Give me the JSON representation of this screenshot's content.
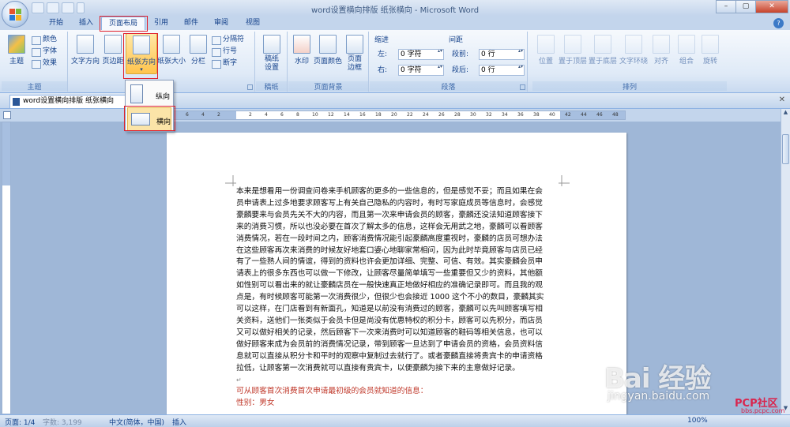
{
  "window": {
    "title": "word设置横向排版 纸张横向 - Microsoft Word"
  },
  "tabs": [
    {
      "label": "开始"
    },
    {
      "label": "插入"
    },
    {
      "label": "页面布局"
    },
    {
      "label": "引用"
    },
    {
      "label": "邮件"
    },
    {
      "label": "审阅"
    },
    {
      "label": "视图"
    }
  ],
  "ribbon": {
    "theme": {
      "big": "主题",
      "colors": "颜色",
      "fonts": "字体",
      "effects": "效果",
      "group": "主题"
    },
    "page_setup": {
      "text_direction": "文字方向",
      "margins": "页边距",
      "orientation": "纸张方向",
      "size": "纸张大小",
      "columns": "分栏",
      "breaks": "分隔符",
      "line_numbers": "行号",
      "hyphenation": "断字"
    },
    "draft": {
      "label": "稿纸设置",
      "group": "稿纸"
    },
    "background": {
      "watermark": "水印",
      "page_color": "页面颜色",
      "page_borders": "页面边框",
      "group": "页面背景"
    },
    "paragraph": {
      "indent": "缩进",
      "spacing": "间距",
      "left_label": "左:",
      "left_value": "0 字符",
      "right_label": "右:",
      "right_value": "0 字符",
      "before_label": "段前:",
      "before_value": "0 行",
      "after_label": "段后:",
      "after_value": "0 行",
      "group": "段落"
    },
    "arrange": {
      "position": "位置",
      "bring_front": "置于顶层",
      "send_back": "置于底层",
      "wrap": "文字环绕",
      "align": "对齐",
      "group_btn": "组合",
      "rotate": "旋转",
      "group": "排列"
    }
  },
  "orientation_menu": {
    "portrait": "纵向",
    "landscape": "横向"
  },
  "doc_tab": {
    "title": "word设置横向排版 纸张横向"
  },
  "document": {
    "lines": [
      "本来是想看用一份调查问卷来手机顾客的更多的一些信息的，但是感觉不妥；而且如果在会",
      "员申请表上过多地要求顾客写上有关自己隐私的内容时，有时写家庭成员等信息时，会感觉",
      "豪麟要来与会员先关不大的内容，而且第一次来申请会员的顾客，豪麟还没法知道顾客接下",
      "来的消费习惯，所以也没必要在首次了解太多的信息，这样会无用武之地，豪麟可以看顾客",
      "消费情况，若在一段时间之内，顾客消费情况能引起豪麟高度重视时，豪麟的店员可想办法",
      "在这些顾客再次来消费的时候友好地套口婆心地聊家常相问，因为此时毕竟顾客与店员已经",
      "有了一些熟人间的情谊，得到的资料也许会更加详细、完整、可信、有效。其实豪麟会员申",
      "请表上的很多东西也可以做一下修改，让顾客尽量简单填写一些重要但又少的资料，其他额",
      "如性别可以看出来的就让豪麟店员在一般快速真正地做好相应的准确记录即可。而且我的观",
      "点是，有时候顾客可能第一次消费很少，但很少也会接近 1000 这个不小的数目，豪麟其实",
      "可以这样，在门店看到有新面孔，知道是以前没有消费过的顾客，豪麟可以先叫顾客填写相",
      "关资料，送他们一张类似于会员卡但是尚没有优惠特权的积分卡，顾客可以先积分，而店员",
      "又可以做好相关的记录，然后顾客下一次来消费时可以知道顾客的鞋码等相关信息，也可以",
      "做好顾客来成为会员前的消费情况记录，带到顾客一旦达到了申请会员的资格，会员资料信",
      "息就可以直接从积分卡和平时的观察中复制过去就行了。或者豪麟直接将贵宾卡的申请资格",
      "拉低，让顾客第一次消费就可以直接有贵宾卡，以便豪麟为接下来的主意做好记录。"
    ],
    "red_line_1": "可从顾客首次消费首次申请最初级的会员就知道的信息：",
    "red_line_2": "性别：男女"
  },
  "ruler_ticks": [
    "6",
    "4",
    "2",
    "",
    "2",
    "4",
    "6",
    "8",
    "10",
    "12",
    "14",
    "16",
    "18",
    "20",
    "22",
    "24",
    "26",
    "28",
    "30",
    "32",
    "34",
    "36",
    "38",
    "40",
    "42",
    "44",
    "46",
    "48"
  ],
  "status": {
    "page": "页面: 1/4",
    "words": "字数: 3,199",
    "lang": "中文(简体，中国)",
    "mode": "插入",
    "zoom": "100%"
  },
  "watermark": {
    "logo": "Bai  经验",
    "url": "jingyan.baidu.com",
    "pc": "PCP社区",
    "site": "bbs.pcpc.com"
  },
  "colors": {
    "ribbon_bg": "#dfeaf7",
    "highlight": "#ffc44d",
    "annotation_red": "#e0202c",
    "workspace": "#9fb7d7"
  }
}
